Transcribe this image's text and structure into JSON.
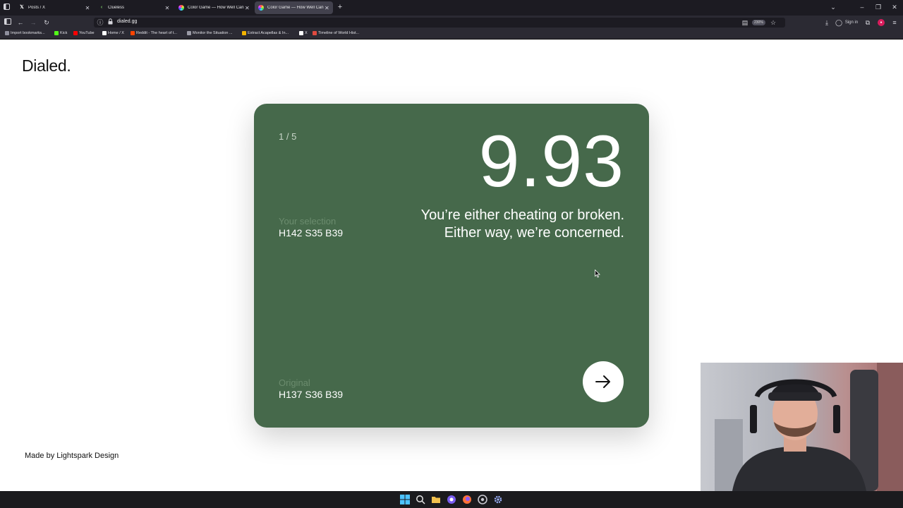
{
  "browser": {
    "tabs": [
      {
        "title": "Posts / X",
        "favicon": "x-logo-icon",
        "active": false
      },
      {
        "title": "Clueless",
        "favicon": "clueless-favicon-icon",
        "active": false
      },
      {
        "title": "Color Game — How Well Can Y",
        "favicon": "color-wheel-icon",
        "active": false
      },
      {
        "title": "Color Game — How Well Can Y",
        "favicon": "color-wheel-icon",
        "active": true
      }
    ],
    "url": "dialed.gg",
    "zoom": "230%",
    "sign_in_label": "Sign in",
    "bookmarks": [
      {
        "label": "Import bookmarks...",
        "color": "#8f8f9d"
      },
      {
        "label": "Kick",
        "color": "#53fc18"
      },
      {
        "label": "YouTube",
        "color": "#ff0000"
      },
      {
        "label": "Home / X",
        "color": "#ffffff"
      },
      {
        "label": "Reddit - The heart of t...",
        "color": "#ff4500"
      },
      {
        "label": "Monitor the Situation ...",
        "color": "#9a9aa5"
      },
      {
        "label": "Extract Acapellas & In...",
        "color": "#f4b400"
      },
      {
        "label": "X",
        "color": "#ffffff"
      },
      {
        "label": "Timeline of World Hist...",
        "color": "#e04a3f"
      }
    ]
  },
  "page": {
    "logo": "Dialed.",
    "credit": "Made by Lightspark Design",
    "card": {
      "background_color": "#46694b",
      "round": "1 / 5",
      "score": "9.93",
      "verdict_line1": "You’re either cheating or broken.",
      "verdict_line2": "Either way, we’re concerned.",
      "selection_label": "Your selection",
      "selection_value": "H142 S35 B39",
      "original_label": "Original",
      "original_value": "H137 S36 B39",
      "next_icon": "arrow-right-icon"
    }
  },
  "overlay": {
    "webcam": "webcam-feed"
  },
  "taskbar": {
    "icons": [
      "windows-start-icon",
      "search-icon",
      "file-explorer-icon",
      "app-icon",
      "browser-icon",
      "browser-icon",
      "settings-gear-icon"
    ]
  }
}
